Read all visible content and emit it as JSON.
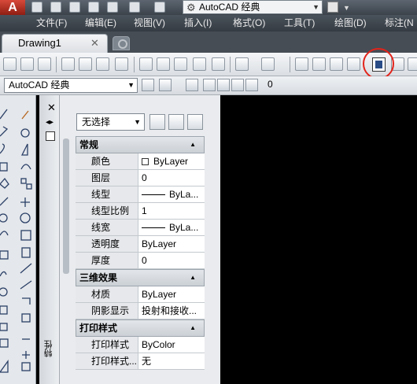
{
  "quick_access": {
    "workspace": "AutoCAD 经典"
  },
  "menu": [
    "文件(F)",
    "编辑(E)",
    "视图(V)",
    "插入(I)",
    "格式(O)",
    "工具(T)",
    "绘图(D)",
    "标注(N"
  ],
  "tabs": {
    "active": "Drawing1"
  },
  "workspace_toolbar": {
    "workspace": "AutoCAD 经典",
    "layer_value": "0"
  },
  "properties": {
    "selection": "无选择",
    "sections": [
      {
        "title": "常规",
        "rows": [
          {
            "key": "颜色",
            "value": "ByLayer",
            "type": "color"
          },
          {
            "key": "图层",
            "value": "0"
          },
          {
            "key": "线型",
            "value": "ByLa...",
            "type": "line"
          },
          {
            "key": "线型比例",
            "value": "1"
          },
          {
            "key": "线宽",
            "value": "ByLa...",
            "type": "line"
          },
          {
            "key": "透明度",
            "value": "ByLayer"
          },
          {
            "key": "厚度",
            "value": "0"
          }
        ]
      },
      {
        "title": "三维效果",
        "rows": [
          {
            "key": "材质",
            "value": "ByLayer"
          },
          {
            "key": "阴影显示",
            "value": "投射和接收..."
          }
        ]
      },
      {
        "title": "打印样式",
        "rows": [
          {
            "key": "打印样式",
            "value": "ByColor"
          },
          {
            "key": "打印样式...",
            "value": "无"
          }
        ]
      }
    ],
    "palette_title": "特性"
  },
  "colors": {
    "highlight": "#e2231a",
    "drawing_bg": "#000000",
    "menu_bg": "#3b424a"
  }
}
